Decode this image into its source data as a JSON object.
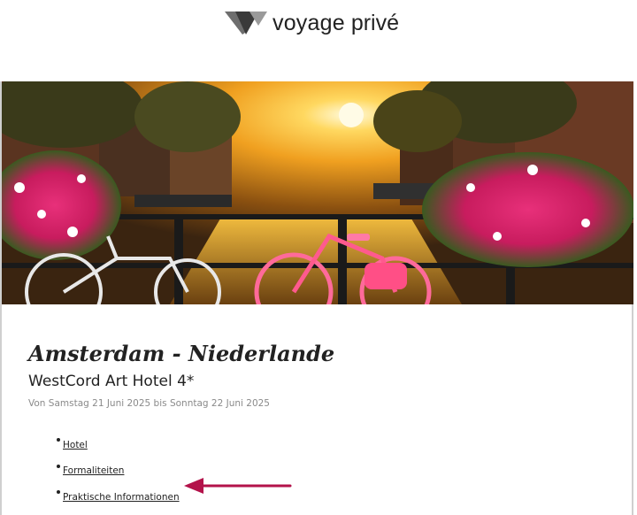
{
  "brand": {
    "name_part1": "voyage",
    "name_part2": "privé",
    "icon": "voyage-prive-v-logo"
  },
  "hero": {
    "icon": "amsterdam-canal-sunset-photo"
  },
  "offer": {
    "destination": "Amsterdam - Niederlande",
    "hotel_name": "WestCord Art Hotel 4*",
    "dates": "Von Samstag 21 Juni 2025 bis Sonntag 22 Juni 2025"
  },
  "links": [
    {
      "label": "Hotel"
    },
    {
      "label": "Formaliteiten"
    },
    {
      "label": "Praktische Informationen"
    }
  ],
  "annotation": {
    "arrow_color": "#b3124a",
    "icon": "left-arrow-annotation"
  }
}
